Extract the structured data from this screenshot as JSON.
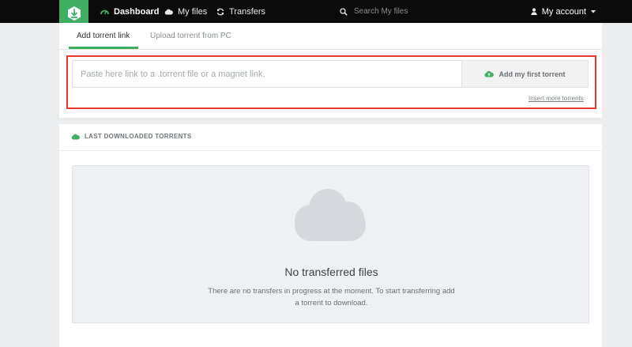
{
  "nav": {
    "items": [
      {
        "label": "Dashboard",
        "icon": "dashboard-icon",
        "active": true
      },
      {
        "label": "My files",
        "icon": "cloud-icon",
        "active": false
      },
      {
        "label": "Transfers",
        "icon": "refresh-icon",
        "active": false
      }
    ],
    "search_placeholder": "Search My files",
    "account_label": "My account"
  },
  "torrent_panel": {
    "tabs": [
      {
        "label": "Add torrent link",
        "active": true
      },
      {
        "label": "Upload torrent from PC",
        "active": false
      }
    ],
    "input_placeholder": "Paste here link to a .torrent file or a magnet link.",
    "add_button_label": "Add my first torrent",
    "insert_more_label": "Insert more torrents"
  },
  "downloads_panel": {
    "section_title": "LAST DOWNLOADED TORRENTS",
    "empty_title": "No transferred files",
    "empty_description": "There are no transfers in progress at the moment. To start transferring add a torrent to download."
  },
  "colors": {
    "accent": "#3fae62",
    "highlight": "#e5392b",
    "topbar": "#0b0b0b"
  }
}
